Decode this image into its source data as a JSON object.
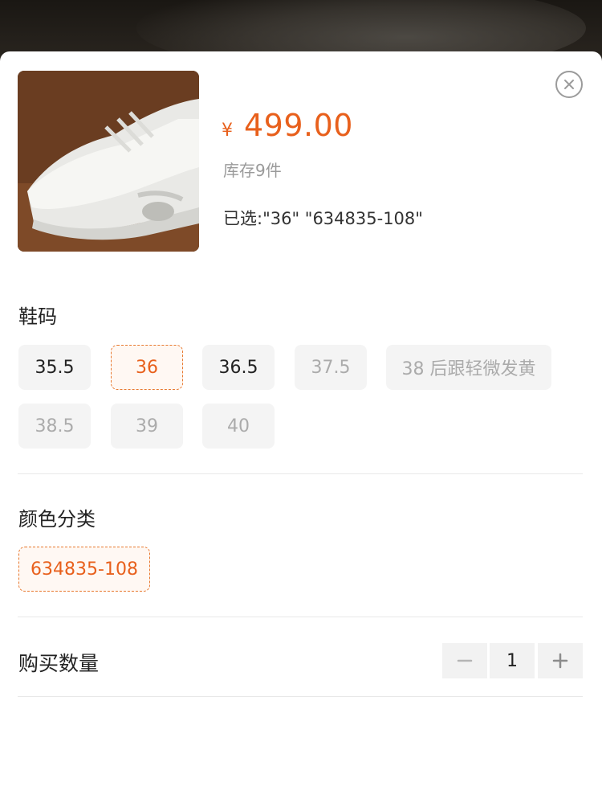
{
  "product": {
    "currency_symbol": "¥",
    "price": "499.00",
    "stock": "库存9件",
    "selected": "已选:\"36\" \"634835-108\""
  },
  "sizes": {
    "title": "鞋码",
    "options": [
      {
        "label": "35.5",
        "state": "available"
      },
      {
        "label": "36",
        "state": "selected"
      },
      {
        "label": "36.5",
        "state": "available"
      },
      {
        "label": "37.5",
        "state": "disabled"
      },
      {
        "label": "38 后跟轻微发黄",
        "state": "disabled"
      },
      {
        "label": "38.5",
        "state": "disabled"
      },
      {
        "label": "39",
        "state": "disabled"
      },
      {
        "label": "40",
        "state": "disabled"
      }
    ]
  },
  "colors": {
    "title": "颜色分类",
    "options": [
      {
        "label": "634835-108",
        "state": "selected"
      }
    ]
  },
  "quantity": {
    "label": "购买数量",
    "value": "1"
  },
  "icons": {
    "close": "close-icon",
    "minus": "minus-icon",
    "plus": "plus-icon"
  },
  "theme": {
    "accent": "#e8601c",
    "chip_bg": "#f4f4f4",
    "disabled_text": "#ababab"
  }
}
